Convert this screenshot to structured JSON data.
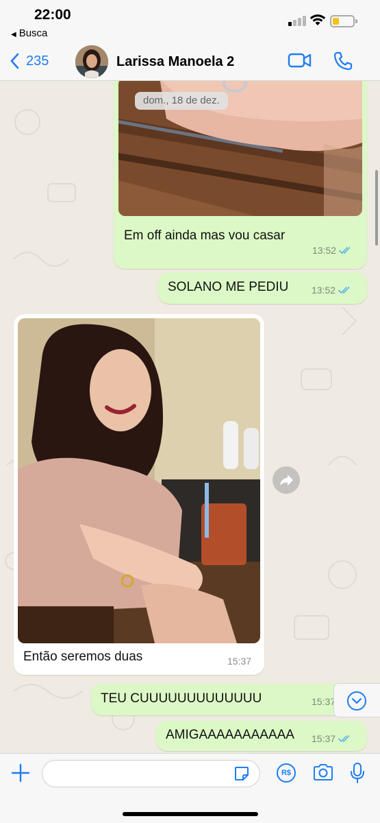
{
  "status_bar": {
    "time": "22:00",
    "back_app_label": "Busca"
  },
  "header": {
    "back_count": "235",
    "contact_name": "Larissa Manoela 2",
    "icons": [
      "chevron-left-icon",
      "video-camera-icon",
      "phone-icon"
    ]
  },
  "chat": {
    "date_pill": "dom., 18 de dez.",
    "messages": [
      {
        "direction": "outgoing",
        "type": "image_caption",
        "text": "Em off ainda mas vou casar",
        "time": "13:52",
        "status": "read"
      },
      {
        "direction": "outgoing",
        "type": "text",
        "text": "SOLANO ME PEDIU",
        "time": "13:52",
        "status": "read"
      },
      {
        "direction": "incoming",
        "type": "image_caption",
        "text": "Então seremos duas",
        "time": "15:37"
      },
      {
        "direction": "outgoing",
        "type": "text",
        "text": "TEU CUUUUUUUUUUUUU",
        "time": "15:37",
        "status": "read"
      },
      {
        "direction": "outgoing",
        "type": "text",
        "text": "AMIGAAAAAAAAAAA",
        "time": "15:37",
        "status": "read"
      }
    ],
    "colors": {
      "outgoing_bubble": "#dcf8c6",
      "incoming_bubble": "#ffffff",
      "read_ticks": "#4fb6ec",
      "accent": "#1e7cf2"
    }
  },
  "composer": {
    "placeholder": "",
    "pay_label": "R$",
    "icons": [
      "plus-icon",
      "sticker-icon",
      "payment-icon",
      "camera-icon",
      "microphone-icon"
    ]
  }
}
